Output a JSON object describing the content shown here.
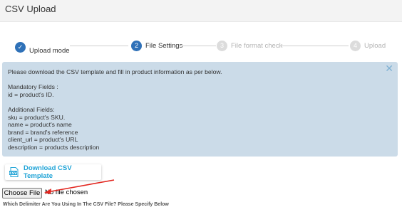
{
  "header": {
    "title": "CSV Upload"
  },
  "stepper": {
    "steps": [
      {
        "label": "Upload mode",
        "number": "✓",
        "state": "done"
      },
      {
        "label": "File Settings",
        "number": "2",
        "state": "active"
      },
      {
        "label": "File format check",
        "number": "3",
        "state": "todo"
      },
      {
        "label": "Upload",
        "number": "4",
        "state": "todo"
      }
    ]
  },
  "info": {
    "close_glyph": "✕",
    "text": "Please download the CSV template and fill in product information as per below.\n\nMandatory Fields :\nid = product's ID.\n\nAdditional Fields:\nsku = product's SKU.\nname = product's name\nbrand = brand's reference\nclient_url = product's URL\ndescription = products description"
  },
  "download": {
    "label": "Download CSV Template",
    "icon": "csv-file-icon"
  },
  "file_input": {
    "button_label": "Choose File",
    "status": "No file chosen"
  },
  "delimiter": {
    "question": "Which Delimiter Are You Using In The CSV File? Please Specify Below"
  },
  "colors": {
    "accent": "#2f71b8",
    "link": "#1fa3d6",
    "info_bg": "#cbdbe8",
    "arrow": "#e2261f"
  }
}
